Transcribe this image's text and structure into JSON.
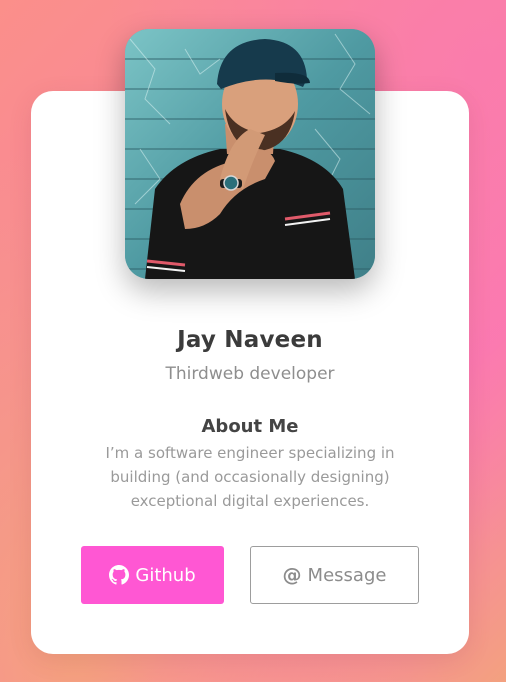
{
  "profile": {
    "name": "Jay Naveen",
    "role": "Thirdweb developer"
  },
  "about": {
    "title": "About Me",
    "text": "I’m a software engineer specializing in building (and occasionally designing) exceptional digital experiences."
  },
  "buttons": {
    "github_label": "Github",
    "github_icon": "github-icon",
    "message_label": "Message",
    "message_icon": "at-icon",
    "message_icon_glyph": "@"
  },
  "colors": {
    "accent": "#ff57d3",
    "name_text": "#3b3b3b",
    "muted_text": "#9a9a9a"
  }
}
